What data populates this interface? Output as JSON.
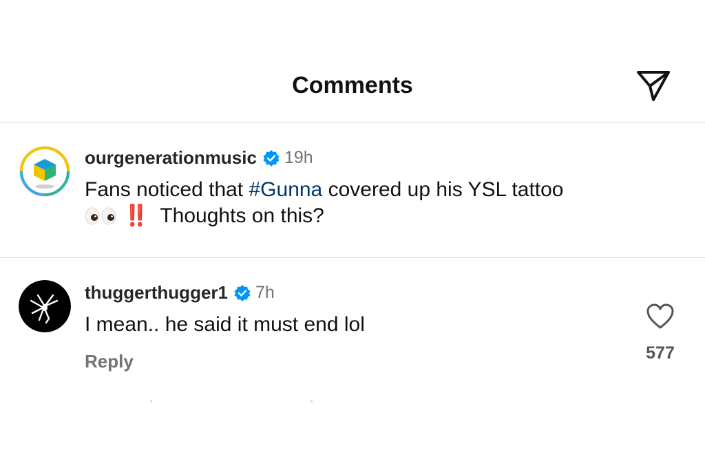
{
  "header": {
    "title": "Comments",
    "share_icon": "send-icon"
  },
  "caption_post": {
    "username": "ourgenerationmusic",
    "verified": true,
    "time": "19h",
    "text_before": "Fans noticed that ",
    "hashtag": "#Gunna",
    "text_after": " covered up his YSL tattoo",
    "line2_emoji": "👀",
    "line2_bang": "‼️",
    "line2_text": "Thoughts on this?"
  },
  "comments": [
    {
      "username": "thuggerthugger1",
      "verified": true,
      "time": "7h",
      "text": "I mean.. he said it must end lol",
      "reply_label": "Reply",
      "like_count": "577"
    }
  ],
  "colors": {
    "accent_verified": "#0095f6",
    "hashtag": "#00376b",
    "secondary_text": "#737373"
  }
}
